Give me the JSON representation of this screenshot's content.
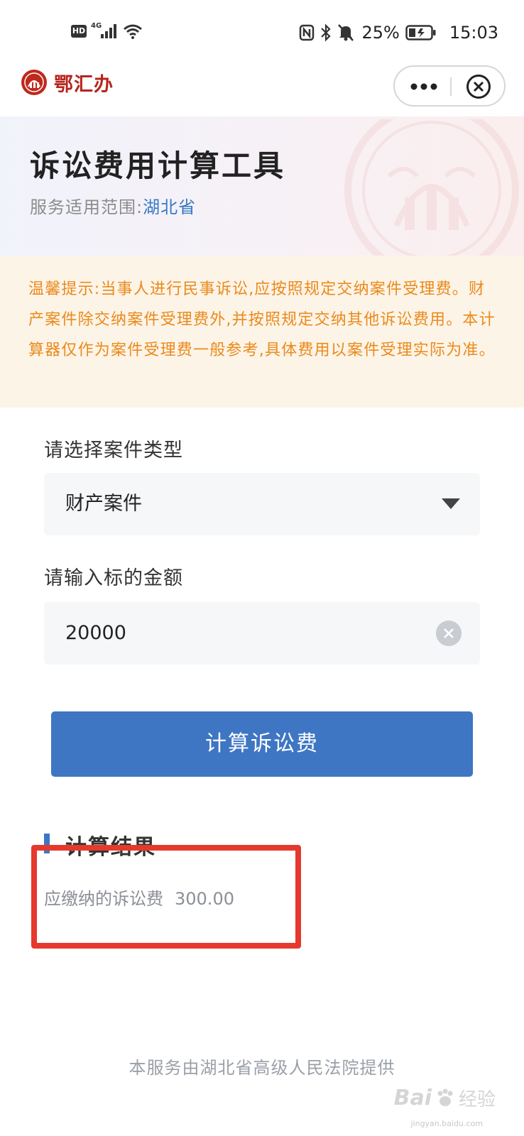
{
  "status_bar": {
    "hd": "HD",
    "network": "4G",
    "battery_percent": "25%",
    "time": "15:03",
    "icons": [
      "hd-icon",
      "signal-icon",
      "wifi-icon",
      "nfc-icon",
      "bluetooth-icon",
      "mute-icon",
      "battery-icon"
    ]
  },
  "header": {
    "app_name": "鄂汇办",
    "more_icon": "more-dots-icon",
    "close_icon": "close-circle-icon"
  },
  "hero": {
    "title": "诉讼费用计算工具",
    "scope_label": "服务适用范围:",
    "scope_value": "湖北省"
  },
  "notice": {
    "text": "温馨提示:当事人进行民事诉讼,应按照规定交纳案件受理费。财产案件除交纳案件受理费外,并按照规定交纳其他诉讼费用。本计算器仅作为案件受理费一般参考,具体费用以案件受理实际为准。"
  },
  "form": {
    "case_type_label": "请选择案件类型",
    "case_type_value": "财产案件",
    "amount_label": "请输入标的金额",
    "amount_value": "20000",
    "calculate_label": "计算诉讼费"
  },
  "result": {
    "title": "计算结果",
    "fee_label": "应缴纳的诉讼费",
    "fee_value": "300.00"
  },
  "footer": {
    "provider": "本服务由湖北省高级人民法院提供"
  },
  "watermark": {
    "brand": "Bai",
    "brand_suffix": "经验",
    "url": "jingyan.baidu.com"
  },
  "colors": {
    "accent": "#3e76c4",
    "notice_text": "#ea8a1b",
    "notice_bg": "#fdf4e8",
    "highlight": "#e5392d",
    "brand_red": "#b5261c"
  }
}
